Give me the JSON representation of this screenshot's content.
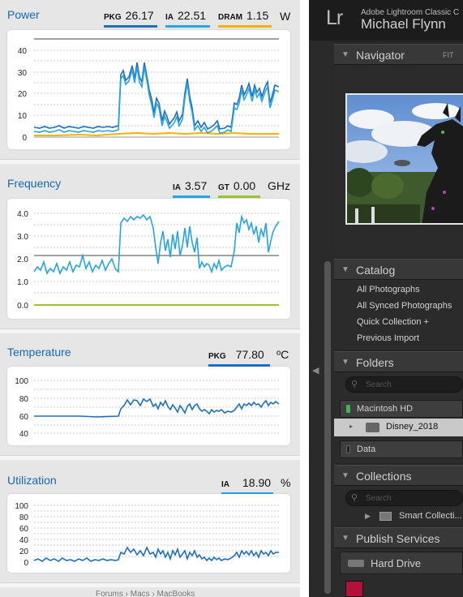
{
  "gadget": {
    "panels": {
      "power": {
        "title": "Power",
        "unit": "W",
        "metrics": [
          {
            "label": "PKG",
            "value": "26.17",
            "color": "#1f6fc1"
          },
          {
            "label": "IA",
            "value": "22.51",
            "color": "#27a4e3"
          },
          {
            "label": "DRAM",
            "value": "1.15",
            "color": "#f4b200"
          }
        ],
        "yticks": [
          "40",
          "30",
          "20",
          "10",
          "0"
        ]
      },
      "frequency": {
        "title": "Frequency",
        "unit": "GHz",
        "metrics": [
          {
            "label": "IA",
            "value": "3.57",
            "color": "#27a4e3"
          },
          {
            "label": "GT",
            "value": "0.00",
            "color": "#9bc232"
          }
        ],
        "yticks": [
          "4.0",
          "3.0",
          "2.0",
          "1.0",
          "0.0"
        ]
      },
      "temperature": {
        "title": "Temperature",
        "unit": "ºC",
        "metrics": [
          {
            "label": "PKG",
            "value": "77.80",
            "color": "#1f6fc1"
          }
        ],
        "yticks": [
          "100",
          "80",
          "60",
          "40"
        ]
      },
      "utilization": {
        "title": "Utilization",
        "unit": "%",
        "metrics": [
          {
            "label": "IA",
            "value": "18.90",
            "color": "#27a4e3"
          }
        ],
        "yticks": [
          "100",
          "80",
          "60",
          "40",
          "20",
          "0"
        ]
      }
    },
    "bottom_strip_text": "Forums  ›  Macs  ›  MacBooks"
  },
  "lightroom": {
    "logo": "Lr",
    "app_name": "Adobe Lightroom Classic C",
    "user_name": "Michael Flynn",
    "navigator": {
      "title": "Navigator",
      "fit": "FIT"
    },
    "catalog": {
      "title": "Catalog",
      "items": [
        "All Photographs",
        "All Synced Photographs",
        "Quick Collection  +",
        "Previous Import"
      ]
    },
    "folders": {
      "title": "Folders",
      "search_placeholder": "Search",
      "volumes": [
        {
          "name": "Macintosh HD",
          "led_color": "#3fb34f"
        },
        {
          "name": "Data",
          "led_color": "#222222"
        }
      ],
      "selected_folder": "Disney_2018"
    },
    "collections": {
      "title": "Collections",
      "search_placeholder": "Search",
      "smart_collection": "Smart Collecti..."
    },
    "publish": {
      "title": "Publish Services",
      "item": "Hard Drive"
    }
  }
}
